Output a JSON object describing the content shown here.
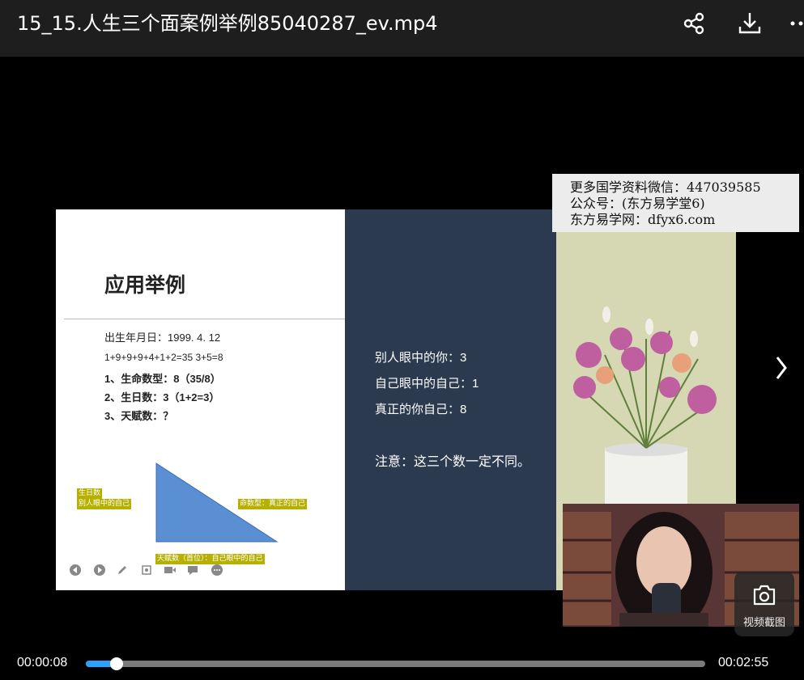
{
  "header": {
    "title": "15_15.人生三个面案例举例85040287_ev.mp4",
    "share_icon": "share-icon",
    "download_icon": "download-icon",
    "more_icon": "more-icon"
  },
  "slide": {
    "heading": "应用举例",
    "lines": [
      "出生年月日：1999. 4. 12",
      "1+9+9+9+4+1+2=35    3+5=8",
      "1、生命数型：8（35/8）",
      "2、生日数：3（1+2=3）",
      "3、天赋数：？"
    ],
    "tags": {
      "birthday": "生日数",
      "others_view": "别人眼中的自己",
      "life_number": "命数型：真正的自己",
      "talent": "天赋数（首位）：自己眼中的自己"
    },
    "right_lines": [
      "别人眼中的你：3",
      "自己眼中的自己：1",
      "真正的你自己：8",
      "注意：这三个数一定不同。"
    ]
  },
  "watermark": {
    "lines": [
      "更多国学资料微信：447039585",
      "公众号：(东方易学堂6)",
      "东方易学网：dfyx6.com"
    ]
  },
  "screenshot_button": {
    "label": "视频截图",
    "icon": "camera-icon"
  },
  "player": {
    "current_time": "00:00:08",
    "duration": "00:02:55",
    "progress": 0.05
  },
  "colors": {
    "accent": "#2aa0ff",
    "slide_dark": "#2b3a4f",
    "tag": "#b6b000",
    "triangle": "#5b8fd4"
  }
}
